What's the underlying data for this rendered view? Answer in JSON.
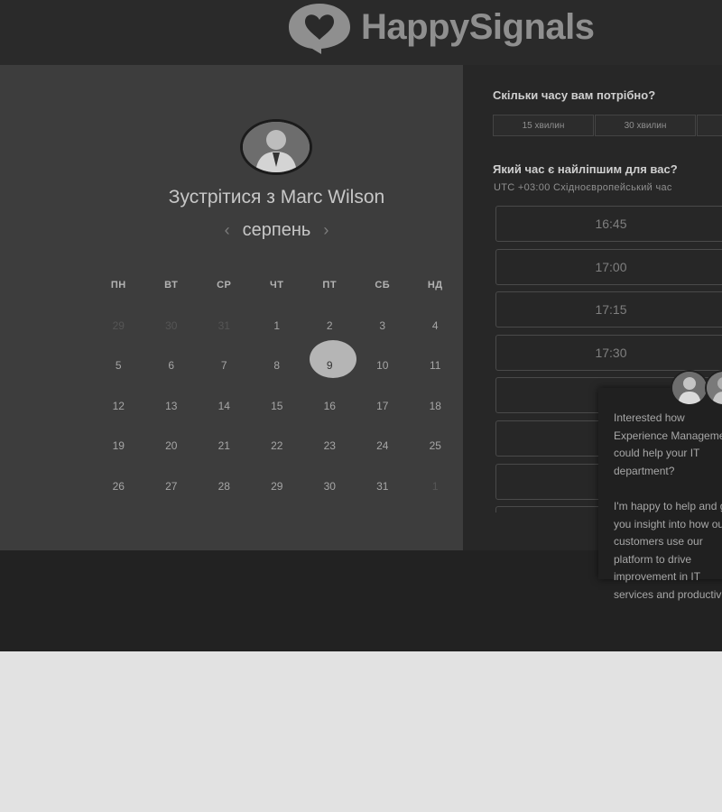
{
  "brand": {
    "logo_text": "HappySignals"
  },
  "scheduler": {
    "title": "Зустрітися з Marc Wilson",
    "month": "серпень",
    "weekdays": [
      "ПН",
      "ВТ",
      "СР",
      "ЧТ",
      "ПТ",
      "СБ",
      "НД"
    ],
    "weeks": [
      [
        "29",
        "30",
        "31",
        "1",
        "2",
        "3",
        "4"
      ],
      [
        "5",
        "6",
        "7",
        "8",
        "9",
        "10",
        "11"
      ],
      [
        "12",
        "13",
        "14",
        "15",
        "16",
        "17",
        "18"
      ],
      [
        "19",
        "20",
        "21",
        "22",
        "23",
        "24",
        "25"
      ],
      [
        "26",
        "27",
        "28",
        "29",
        "30",
        "31",
        "1"
      ]
    ],
    "selected_day": "9"
  },
  "booking": {
    "duration_question": "Скільки часу вам потрібно?",
    "durations": [
      "15 хвилин",
      "30 хвилин",
      ""
    ],
    "time_question": "Який час є найліпшим для вас?",
    "timezone": "UTC +03:00 Східноєвропейський час",
    "slots": [
      "16:45",
      "17:00",
      "17:15",
      "17:30",
      "",
      "",
      "",
      ""
    ]
  },
  "chat": {
    "message": "Interested how Experience Management could help your IT department?\n\nI'm happy to help and give you insight into how our customers use our platform to drive improvement in IT services and productivity."
  },
  "colors": {
    "selected_day_bg": "#b5b5b5",
    "header_bg": "#2a2a2a",
    "left_panel_bg": "#3d3d3d"
  }
}
